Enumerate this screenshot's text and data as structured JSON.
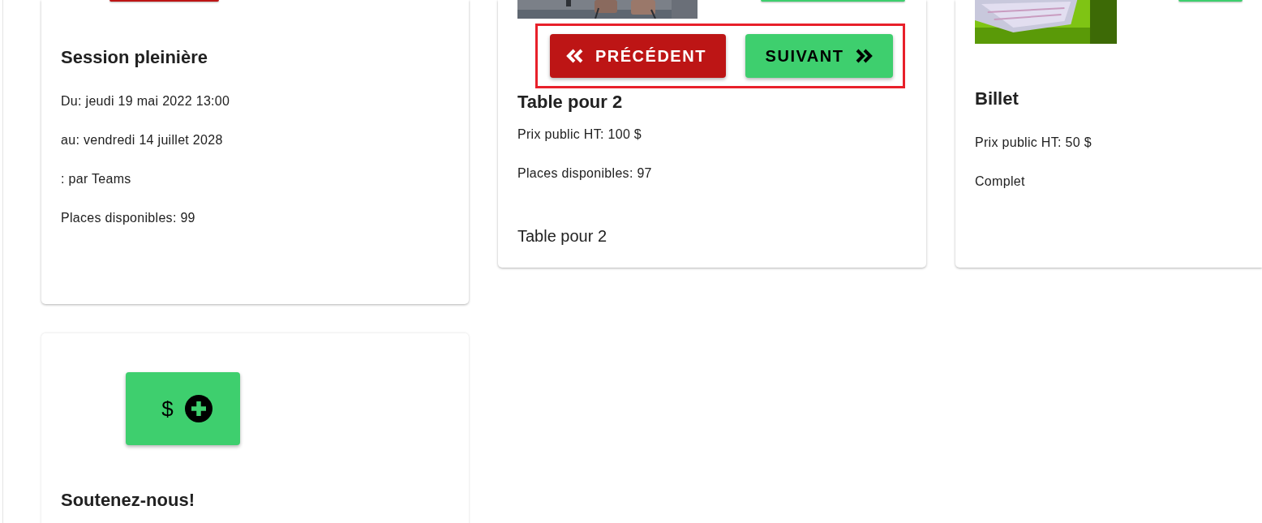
{
  "cards": [
    {
      "media": [
        {
          "kind": "danger_button"
        }
      ],
      "title": "Session pleinière",
      "lines": [
        "Du: jeudi 19 mai 2022 13:00",
        "au: vendredi 14 juillet 2028",
        ": par Teams",
        "Places disponibles: 99"
      ]
    },
    {
      "media": [
        {
          "kind": "picture"
        },
        {
          "kind": "success_button"
        }
      ],
      "title": "Table pour 2",
      "lines": [
        "Prix public HT: 100 $",
        "Places disponibles: 97"
      ],
      "footer": "Table pour 2",
      "navigation": [
        {
          "kind": "previous",
          "label": "PRÉCÉDENT"
        },
        {
          "kind": "next",
          "label": "SUIVANT"
        }
      ]
    },
    {
      "media": [
        {
          "kind": "picture"
        },
        {
          "kind": "success_button"
        }
      ],
      "title": "Billet",
      "lines": [
        "Prix public HT: 50 $",
        "Complet"
      ]
    },
    {
      "donate_button": {
        "label": "$"
      },
      "title": "Soutenez-nous!"
    }
  ]
}
